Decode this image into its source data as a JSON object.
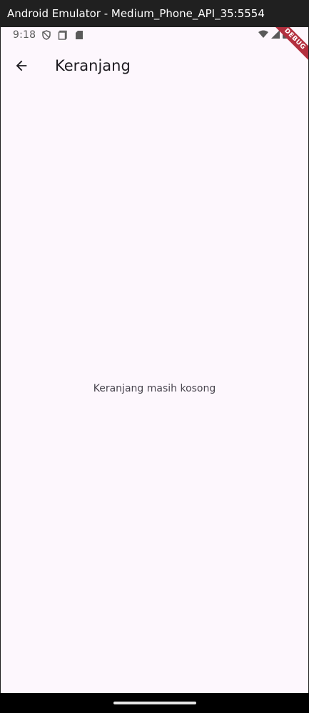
{
  "window": {
    "title": "Android Emulator - Medium_Phone_API_35:5554"
  },
  "status_bar": {
    "time": "9:18",
    "left_icons": [
      "shield-icon",
      "screenshot-icon",
      "sd-card-icon"
    ],
    "right_icons": [
      "wifi-icon",
      "signal-icon",
      "battery-icon"
    ],
    "debug_banner": "DEBUG"
  },
  "app_bar": {
    "title": "Keranjang",
    "back_icon": "arrow-back-icon"
  },
  "main": {
    "empty_message": "Keranjang masih kosong"
  },
  "colors": {
    "background": "#fdf7fd",
    "text": "#1d1b20",
    "debug": "#b3303f"
  }
}
